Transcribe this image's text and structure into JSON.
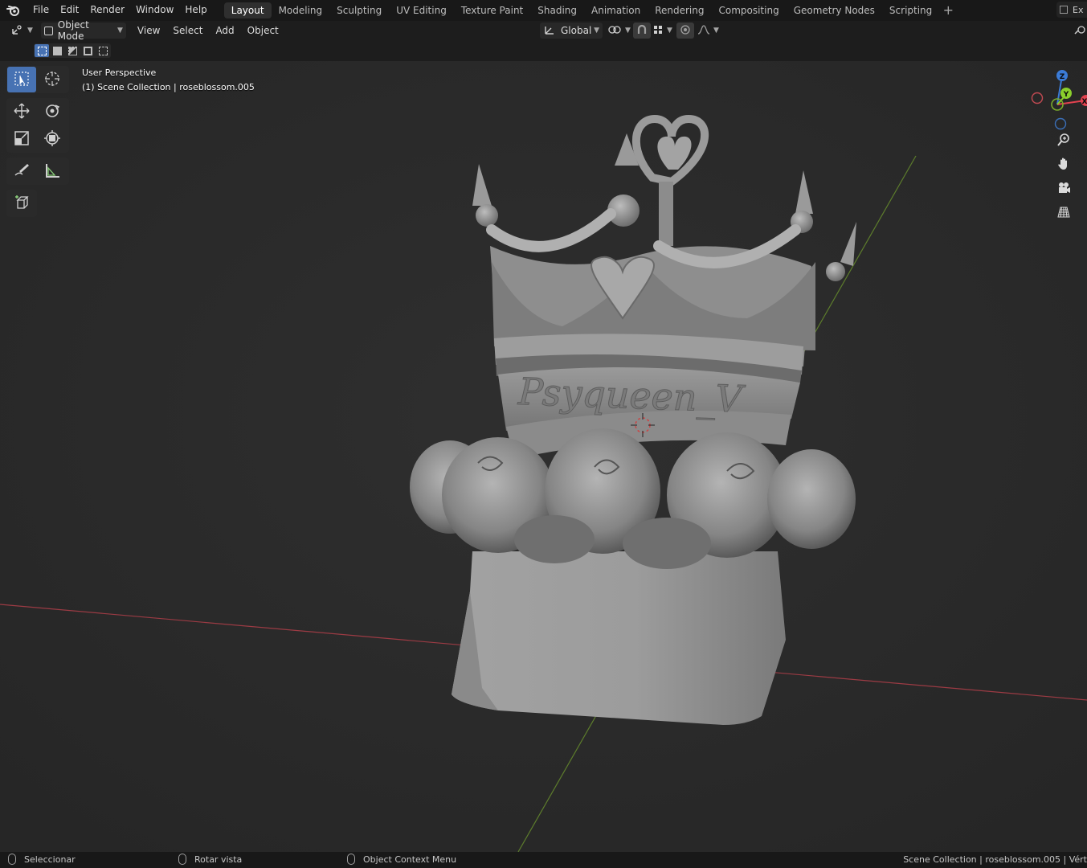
{
  "menu": {
    "items": [
      "File",
      "Edit",
      "Render",
      "Window",
      "Help"
    ]
  },
  "workspaces": {
    "tabs": [
      "Layout",
      "Modeling",
      "Sculpting",
      "UV Editing",
      "Texture Paint",
      "Shading",
      "Animation",
      "Rendering",
      "Compositing",
      "Geometry Nodes",
      "Scripting"
    ],
    "active": "Layout",
    "corner_label": "Ex"
  },
  "header": {
    "mode": "Object Mode",
    "menus": [
      "View",
      "Select",
      "Add",
      "Object"
    ],
    "transform_orientation": "Global"
  },
  "viewport": {
    "perspective_label": "User Perspective",
    "collection_label": "(1) Scene Collection | roseblossom.005",
    "model_text": "Psyqueen_V",
    "gizmo_axes": [
      "Z",
      "Y",
      "X"
    ]
  },
  "toolbar": {
    "tools": [
      "select-box",
      "cursor",
      "move",
      "rotate",
      "scale",
      "transform",
      "annotate",
      "measure",
      "add-cube"
    ],
    "active_tool": "select-box"
  },
  "colors": {
    "accent": "#4772b3",
    "x_axis": "#e2424f",
    "y_axis": "#8acf2c",
    "z_axis": "#3b7bd6"
  },
  "statusbar": {
    "left_action": "Seleccionar",
    "middle_action": "Rotar vista",
    "right_action": "Object Context Menu",
    "info": "Scene Collection | roseblossom.005 | Vért"
  }
}
